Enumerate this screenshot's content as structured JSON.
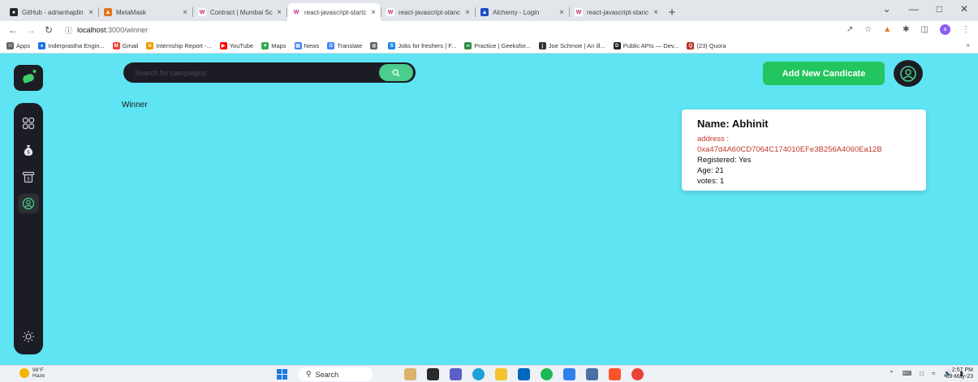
{
  "browser": {
    "tabs": [
      {
        "title": "GitHub - adrianhajdin",
        "favicon_color": "#24292f",
        "favicon_glyph": "●",
        "active": false
      },
      {
        "title": "MetaMask",
        "favicon_color": "#e2761b",
        "favicon_glyph": "▲",
        "active": false
      },
      {
        "title": "Contract | Mumbai Sc",
        "favicon_color": "#ffffff",
        "favicon_glyph": "W",
        "favicon_text_color": "#c0247b",
        "active": false
      },
      {
        "title": "react-javascript-startc",
        "favicon_color": "#ffffff",
        "favicon_glyph": "W",
        "favicon_text_color": "#c0247b",
        "active": true
      },
      {
        "title": "react-javascript-stanc",
        "favicon_color": "#ffffff",
        "favicon_glyph": "W",
        "favicon_text_color": "#c0247b",
        "active": false
      },
      {
        "title": "Alchemy - Login",
        "favicon_color": "#1f4cc9",
        "favicon_glyph": "▲",
        "active": false
      },
      {
        "title": "react-javascript-stanc",
        "favicon_color": "#ffffff",
        "favicon_glyph": "W",
        "favicon_text_color": "#c0247b",
        "active": false
      }
    ],
    "url_host": "localhost",
    "url_path": ":3000/winner",
    "bookmarks": [
      {
        "label": "Apps",
        "color": "#5f6368",
        "glyph": "∷"
      },
      {
        "label": "Inderprastha Engin...",
        "color": "#1a73e8",
        "glyph": "●"
      },
      {
        "label": "Gmail",
        "color": "#ea4335",
        "glyph": "M"
      },
      {
        "label": "Internship Report -...",
        "color": "#f29900",
        "glyph": "σ"
      },
      {
        "label": "YouTube",
        "color": "#ff0000",
        "glyph": "▶"
      },
      {
        "label": "Maps",
        "color": "#34a853",
        "glyph": "▼"
      },
      {
        "label": "News",
        "color": "#4285f4",
        "glyph": "▤"
      },
      {
        "label": "Translate",
        "color": "#4285f4",
        "glyph": "G"
      },
      {
        "label": "",
        "color": "#5f6368",
        "glyph": "◎"
      },
      {
        "label": "Jobs for freshers | F...",
        "color": "#1e88e5",
        "glyph": "S"
      },
      {
        "label": "Practice | Geeksfor...",
        "color": "#2f8d46",
        "glyph": "∞"
      },
      {
        "label": "Joe Schmoe | An ill...",
        "color": "#333333",
        "glyph": "j"
      },
      {
        "label": "Public APIs — Dev...",
        "color": "#222222",
        "glyph": "D"
      },
      {
        "label": "(23) Quora",
        "color": "#b92b27",
        "glyph": "Q"
      }
    ]
  },
  "app": {
    "search_placeholder": "Search for campaigns",
    "add_button_label": "Add New Candicate",
    "page_title": "Winner",
    "accent_green": "#22c55e",
    "background": "#5ee4f2",
    "sidebar_items": [
      {
        "icon": "dashboard-icon",
        "active": false
      },
      {
        "icon": "money-bag-icon",
        "active": false
      },
      {
        "icon": "payment-icon",
        "active": false
      },
      {
        "icon": "profile-icon",
        "active": true
      },
      {
        "icon": "sun-icon",
        "active": false
      }
    ],
    "winner_card": {
      "name": "Name: Abhinit",
      "address_label": "address :",
      "address_value": "0xa47d4A60CD7064C174010EFe3B256A4060Ea12B",
      "registered": "Registered: Yes",
      "age": "Age: 21",
      "votes": "votes: 1"
    }
  },
  "taskbar": {
    "weather_temp": "98°F",
    "weather_desc": "Haze",
    "search_label": "Search",
    "time": "2:57 PM",
    "date": "09-May-23"
  }
}
